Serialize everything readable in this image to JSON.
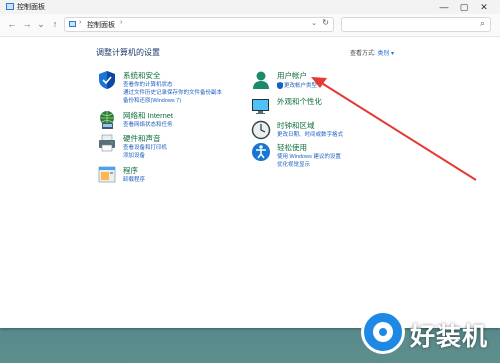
{
  "window": {
    "title": "控制面板",
    "controls": {
      "minimize": "—",
      "maximize": "▢",
      "close": "✕"
    }
  },
  "toolbar": {
    "back": "←",
    "forward": "→",
    "recent": "⌄",
    "up": "↑",
    "address": {
      "crumb": "控制面板",
      "separator": "›",
      "dropdown": "⌄",
      "refresh": "↻"
    },
    "search": {
      "placeholder": "",
      "icon": "search-icon"
    }
  },
  "main": {
    "heading": "调整计算机的设置",
    "view_by": {
      "label": "查看方式:",
      "value": "类别 ▾"
    },
    "categories": [
      {
        "title": "系统和安全",
        "links": [
          "查看你的计算机状态",
          "通过文件历史记录保存你的文件备份副本",
          "备份和还原(Windows 7)"
        ],
        "icon": "shield-icon"
      },
      {
        "title": "网络和 Internet",
        "links": [
          "查看网络状态和任务"
        ],
        "icon": "network-icon"
      },
      {
        "title": "硬件和声音",
        "links": [
          "查看设备和打印机",
          "添加设备"
        ],
        "icon": "printer-icon"
      },
      {
        "title": "程序",
        "links": [
          "卸载程序"
        ],
        "icon": "programs-icon"
      },
      {
        "title": "用户帐户",
        "links": [
          "更改帐户类型"
        ],
        "icon": "user-icon"
      },
      {
        "title": "外观和个性化",
        "links": [],
        "icon": "appearance-icon"
      },
      {
        "title": "时钟和区域",
        "links": [
          "更改日期、时间或数字格式"
        ],
        "icon": "clock-icon"
      },
      {
        "title": "轻松使用",
        "links": [
          "使用 Windows 建议的设置",
          "优化视觉显示"
        ],
        "icon": "accessibility-icon"
      }
    ]
  },
  "watermark": {
    "text": "好装机",
    "color": "#1e88e5"
  },
  "colors": {
    "category_title": "#0f6e3d",
    "link": "#1f5fbf",
    "heading": "#1a3a6b",
    "arrow": "#e53935"
  }
}
